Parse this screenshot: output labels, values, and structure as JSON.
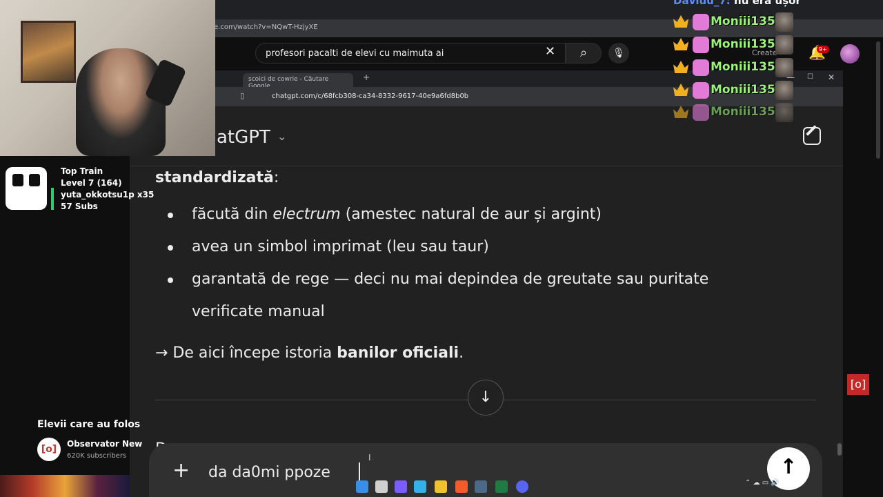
{
  "youtube": {
    "url": "e.com/watch?v=NQwT-HzjyXE",
    "search_query": "profesori pacalti de elevi cu maimuta ai",
    "create_label": "Create",
    "notifications_badge": "9+",
    "video_title": "Elevii care au folos",
    "channel_name": "Observator New",
    "channel_subs": "620K subscribers"
  },
  "chatgpt_window": {
    "tab_title": "scoici de cowrie - Căutare Google",
    "url": "chatgpt.com/c/68fcb308-ca34-8332-9617-40e9a6fd8b0b",
    "app_title": "atGPT",
    "content": {
      "heading": "standardizată",
      "heading_suffix": ":",
      "bullets": [
        {
          "pre": "făcută din ",
          "em": "electrum",
          "post": " (amestec natural de aur și argint)"
        },
        {
          "pre": "avea un simbol imprimat (leu sau taur)",
          "em": "",
          "post": ""
        },
        {
          "pre": "garantată de rege — deci nu mai depindea de greutate sau puritate",
          "em": "",
          "post": ""
        }
      ],
      "bullet3_cont": "verificate manual",
      "conclusion_pre": "→ De aici începe istoria ",
      "conclusion_bold": "banilor oficiali",
      "conclusion_post": ".",
      "partial_line": "D"
    },
    "composer": {
      "input_value": "da da0mi ppoze"
    }
  },
  "stream_overlay": {
    "top_train": {
      "title": "Top Train",
      "level": "Level 7  (164)",
      "top_user": "yuta_okkotsu1p x35",
      "subs": "57 Subs"
    },
    "chat_top_user": "Daviuu_7:",
    "chat_top_msg": "nu era ușor",
    "chat_messages": [
      "Moniii135:",
      "Moniii135:",
      "Moniii135:",
      "Moniii135:",
      "Moniii135:"
    ]
  },
  "colors": {
    "chat_name": "#9cf27a",
    "crown": "#f2b01e",
    "chatgpt_bg": "#212121",
    "youtube_bg": "#0f0f0f"
  },
  "icons": [
    "search-icon",
    "mic-icon",
    "bell-icon",
    "close-icon",
    "plus-icon",
    "arrow-up-icon",
    "arrow-down-icon",
    "edit-icon",
    "record-icon",
    "crown-icon"
  ]
}
